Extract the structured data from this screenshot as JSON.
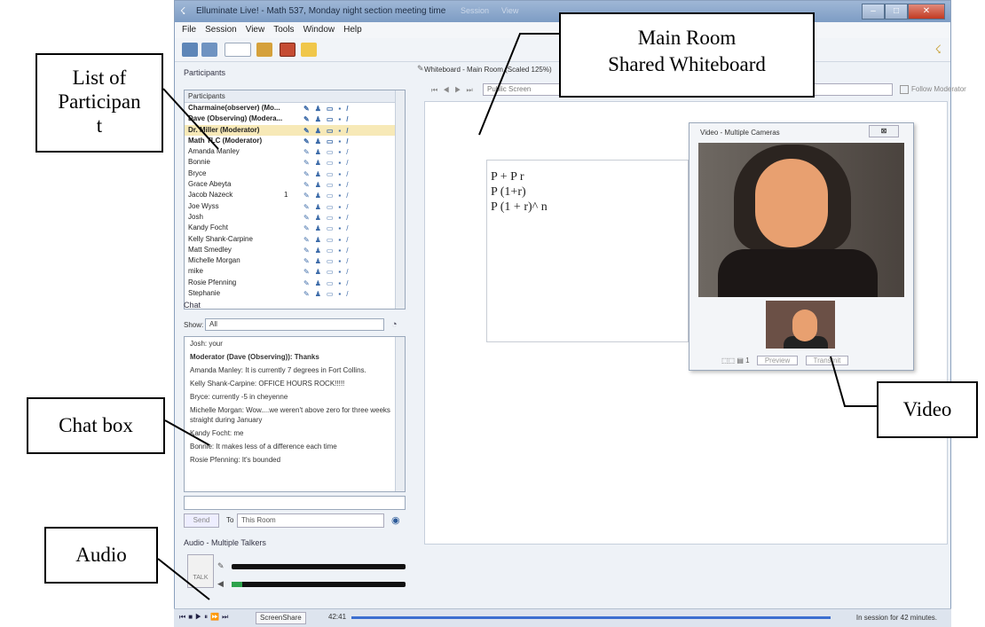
{
  "window": {
    "title": "Elluminate Live! - Math 537, Monday night section meeting time",
    "tabs": [
      "Session",
      "View"
    ],
    "buttons": {
      "minimize": "–",
      "maximize": "□",
      "close": "✕"
    }
  },
  "menubar": [
    "File",
    "Session",
    "View",
    "Tools",
    "Window",
    "Help"
  ],
  "participants": {
    "section_title": "Participants",
    "header": "Participants",
    "rows": [
      {
        "name": "Charmaine(observer) (Mo...",
        "bold": true,
        "num": "",
        "selected": false
      },
      {
        "name": "Dave (Observing) (Modera...",
        "bold": true,
        "num": "",
        "selected": false
      },
      {
        "name": "Dr. Miller (Moderator)",
        "bold": true,
        "num": "",
        "selected": true
      },
      {
        "name": "Math TLC (Moderator)",
        "bold": true,
        "num": "",
        "selected": false
      },
      {
        "name": "Amanda Manley",
        "bold": false,
        "num": "",
        "selected": false
      },
      {
        "name": "Bonnie",
        "bold": false,
        "num": "",
        "selected": false
      },
      {
        "name": "Bryce",
        "bold": false,
        "num": "",
        "selected": false
      },
      {
        "name": "Grace Abeyta",
        "bold": false,
        "num": "",
        "selected": false
      },
      {
        "name": "Jacob Nazeck",
        "bold": false,
        "num": "1",
        "selected": false
      },
      {
        "name": "Joe Wyss",
        "bold": false,
        "num": "",
        "selected": false
      },
      {
        "name": "Josh",
        "bold": false,
        "num": "",
        "selected": false
      },
      {
        "name": "Kandy Focht",
        "bold": false,
        "num": "",
        "selected": false
      },
      {
        "name": "Kelly Shank-Carpine",
        "bold": false,
        "num": "",
        "selected": false
      },
      {
        "name": "Matt Smedley",
        "bold": false,
        "num": "",
        "selected": false
      },
      {
        "name": "Michelle Morgan",
        "bold": false,
        "num": "",
        "selected": false
      },
      {
        "name": "mike",
        "bold": false,
        "num": "",
        "selected": false
      },
      {
        "name": "Rosie Pfenning",
        "bold": false,
        "num": "",
        "selected": false
      },
      {
        "name": "Stephanie",
        "bold": false,
        "num": "",
        "selected": false
      }
    ]
  },
  "chat": {
    "section_title": "Chat",
    "show_label": "Show:",
    "show_value": "All",
    "messages": [
      {
        "text": "Josh: your",
        "bold": false
      },
      {
        "text": "Moderator (Dave (Observing)): Thanks",
        "bold": true
      },
      {
        "text": "Amanda Manley: It is currently 7 degrees in Fort Collins.",
        "bold": false
      },
      {
        "text": "Kelly Shank-Carpine: OFFICE HOURS ROCK!!!!!",
        "bold": false
      },
      {
        "text": "Bryce: currently -5 in cheyenne",
        "bold": false
      },
      {
        "text": "Michelle Morgan: Wow....we weren't above zero for three weeks straight during January",
        "bold": false
      },
      {
        "text": "Kandy Focht: me",
        "bold": false
      },
      {
        "text": "Bonnie: It makes less of a difference each time",
        "bold": false
      },
      {
        "text": "Rosie Pfenning: It's bounded",
        "bold": false
      }
    ],
    "send_label": "Send",
    "to_label": "To",
    "to_value": "This Room"
  },
  "audio": {
    "section_title": "Audio - Multiple Talkers",
    "talk_label": "TALK",
    "mic_level": 0,
    "speaker_level": 0.06
  },
  "whiteboard": {
    "title": "Whiteboard - Main Room (Scaled 125%)",
    "screen": "Public Screen",
    "follow_label": "Follow Moderator",
    "equations": [
      "P + P r",
      "P (1+r)",
      "P (1 + r)^ n"
    ]
  },
  "video": {
    "title": "Video - Multiple Cameras",
    "count": "1",
    "preview_label": "Preview",
    "transmit_label": "Transmit"
  },
  "bottombar": {
    "recorder": "ScreenShare",
    "time": "42:41",
    "session": "In session for 42 minutes."
  },
  "annotations": {
    "list": [
      "List of",
      "Participan",
      "t"
    ],
    "main": [
      "Main Room",
      "Shared Whiteboard"
    ],
    "chat": "Chat box",
    "video": "Video",
    "audio": "Audio"
  }
}
